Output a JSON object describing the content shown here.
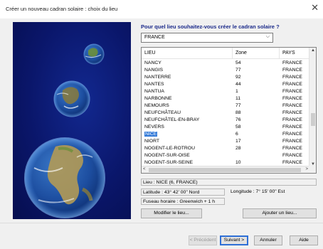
{
  "window": {
    "title": "Créer un nouveau cadran solaire : choix du lieu",
    "close_glyph": "✕"
  },
  "question": "Pour quel lieu souhaitez-vous créer le cadran solaire ?",
  "country_combo": {
    "value": "FRANCE",
    "arrow": "⌵"
  },
  "list": {
    "columns": [
      "LIEU",
      "Zone",
      "PAYS"
    ],
    "rows": [
      [
        "NANCY",
        "54",
        "FRANCE"
      ],
      [
        "NANGIS",
        "77",
        "FRANCE"
      ],
      [
        "NANTERRE",
        "92",
        "FRANCE"
      ],
      [
        "NANTES",
        "44",
        "FRANCE"
      ],
      [
        "NANTUA",
        "1",
        "FRANCE"
      ],
      [
        "NARBONNE",
        "11",
        "FRANCE"
      ],
      [
        "NEMOURS",
        "77",
        "FRANCE"
      ],
      [
        "NEUFCHÂTEAU",
        "88",
        "FRANCE"
      ],
      [
        "NEUFCHÂTEL-EN-BRAY",
        "76",
        "FRANCE"
      ],
      [
        "NEVERS",
        "58",
        "FRANCE"
      ],
      [
        "NICE",
        "6",
        "FRANCE"
      ],
      [
        "NIORT",
        "17",
        "FRANCE"
      ],
      [
        "NOGENT-LE-ROTROU",
        "28",
        "FRANCE"
      ],
      [
        "NOGENT-SUR-OISE",
        "",
        "FRANCE"
      ],
      [
        "NOGENT-SUR-SEINE",
        "10",
        "FRANCE"
      ]
    ],
    "selected_index": 10,
    "scroll_up": "▲",
    "scroll_down": "▼",
    "scroll_left": "<",
    "scroll_right": ">"
  },
  "details": {
    "lieu": "Lieu : NICE (6, FRANCE)",
    "latitude": "Latitude : 43° 42' 00\" Nord",
    "longitude": "Longitude : 7° 15' 00\" Est",
    "fuseau": "Fuseau horaire : Greenwich + 1 h"
  },
  "buttons": {
    "modifier": "Modifier le lieu...",
    "ajouter": "Ajouter un lieu...",
    "precedent": "< Précédent",
    "suivant": "Suivant >",
    "annuler": "Annuler",
    "aide": "Aide"
  },
  "colors": {
    "accent": "#3078d7",
    "question_text": "#1b2a8a",
    "space_background": "#0b1a73"
  }
}
